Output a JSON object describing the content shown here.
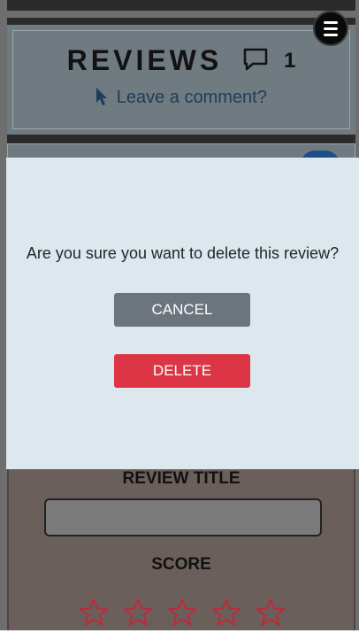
{
  "reviews_header": {
    "title": "REVIEWS",
    "comment_count": "1",
    "comment_icon": "speech-bubble-icon",
    "leave_comment": "Leave a comment?",
    "cursor_icon": "pointer-cursor-icon"
  },
  "menu": {
    "icon": "hamburger-menu-icon"
  },
  "modal": {
    "question": "Are you sure you want to delete this review?",
    "cancel_label": "CANCEL",
    "delete_label": "DELETE"
  },
  "review_form": {
    "title_label": "REVIEW TITLE",
    "title_value": "",
    "score_label": "SCORE",
    "score_stars_total": 5,
    "score_stars_filled": 0,
    "star_icon": "star-outline-icon"
  },
  "colors": {
    "cancel_button": "#6c757d",
    "delete_button": "#dc3545",
    "modal_background": "#dce8ed",
    "star_outline": "#c0283a"
  }
}
